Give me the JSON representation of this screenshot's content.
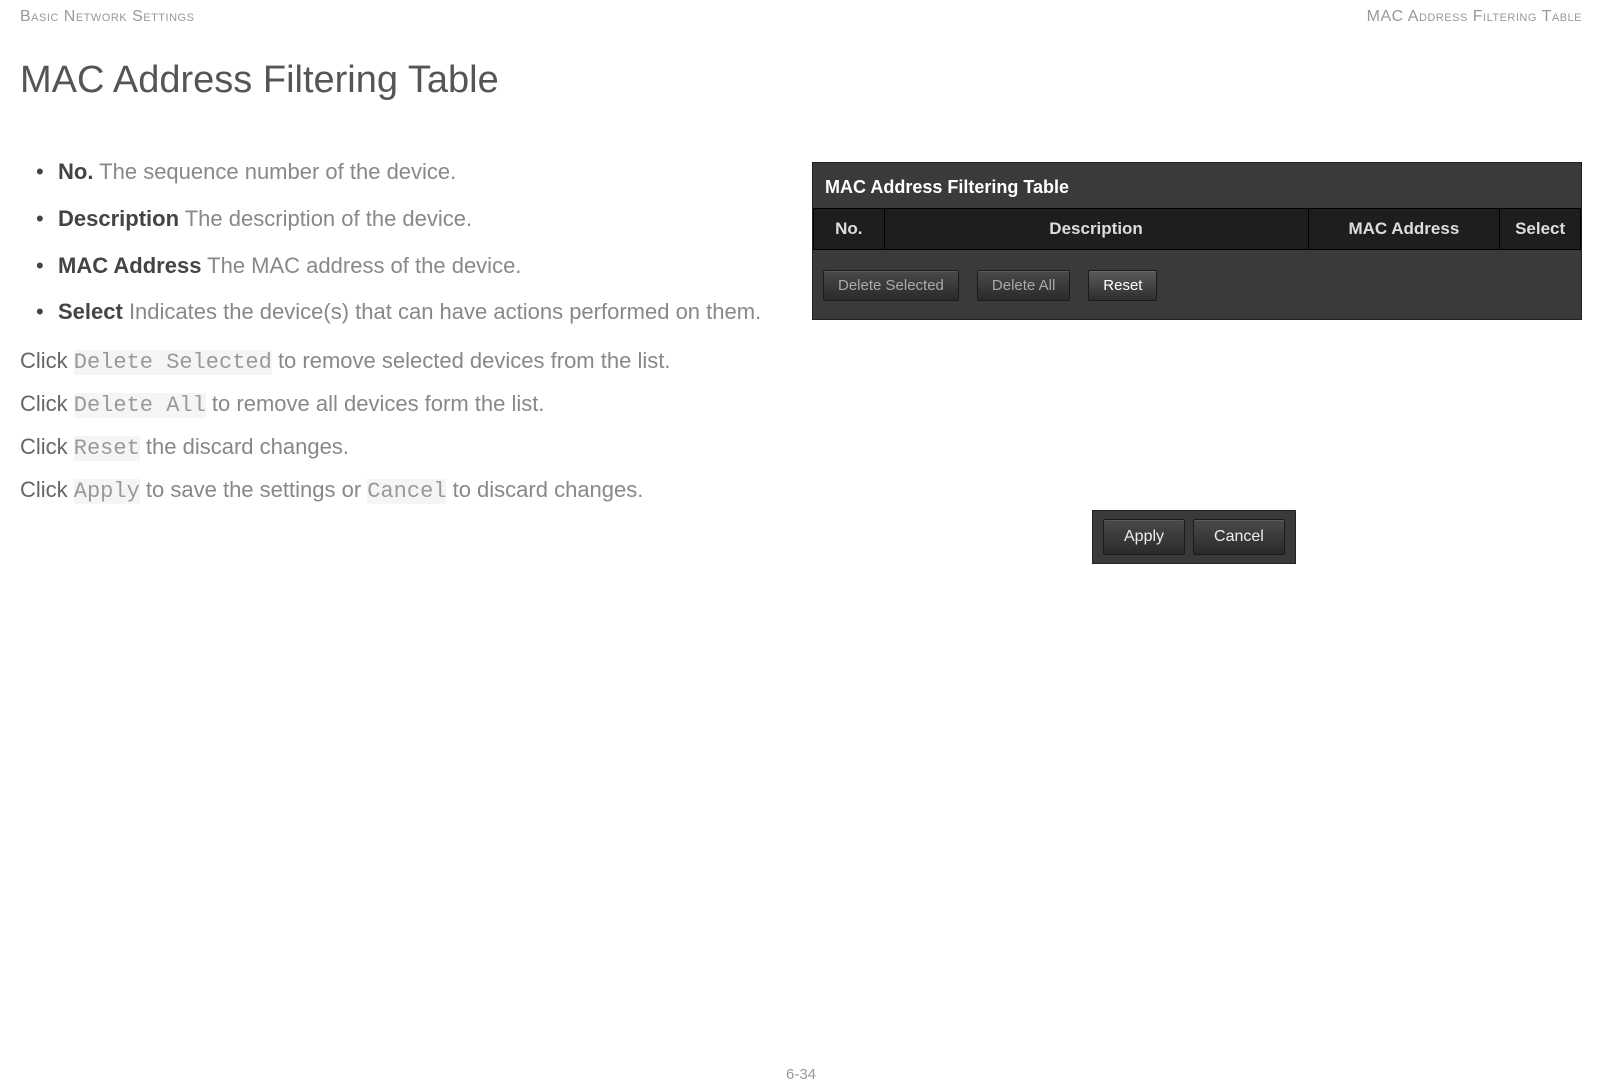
{
  "header": {
    "left": "Basic Network Settings",
    "right": "MAC Address Filtering Table"
  },
  "title": "MAC Address Filtering Table",
  "bullets": [
    {
      "term": "No.",
      "desc": "  The sequence number of the device."
    },
    {
      "term": "Description",
      "desc": "  The description of the device."
    },
    {
      "term": "MAC Address",
      "desc": "  The MAC address of the device."
    },
    {
      "term": "Select",
      "desc": "  Indicates the device(s) that can have actions per­formed on them."
    }
  ],
  "paras": {
    "p1_a": "Click ",
    "p1_code": "Delete Selected",
    "p1_b": " to remove selected devices from the list.",
    "p2_a": "Click ",
    "p2_code": "Delete All",
    "p2_b": " to remove all devices form the list.",
    "p3_a": "Click ",
    "p3_code": "Reset",
    "p3_b": " the discard changes.",
    "p4_a": "Click ",
    "p4_code1": "Apply",
    "p4_mid": " to save the settings or ",
    "p4_code2": "Cancel",
    "p4_b": " to discard changes."
  },
  "widget": {
    "title": "MAC Address Filtering Table",
    "cols": {
      "no": "No.",
      "desc": "Description",
      "mac": "MAC Address",
      "sel": "Select"
    },
    "buttons": {
      "del_sel": "Delete Selected",
      "del_all": "Delete All",
      "reset": "Reset"
    }
  },
  "apply_cancel": {
    "apply": "Apply",
    "cancel": "Cancel"
  },
  "footer": "6-34"
}
